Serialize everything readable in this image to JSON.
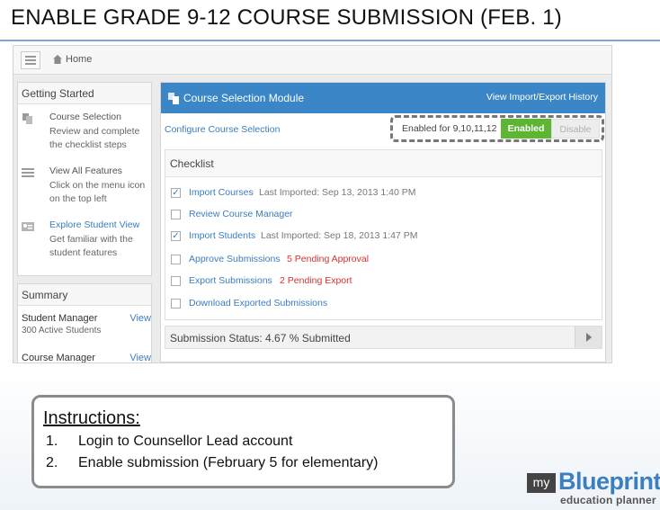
{
  "slide": {
    "title": "ENABLE GRADE 9-12 COURSE SUBMISSION (FEB. 1)"
  },
  "app": {
    "breadcrumb": {
      "home_label": "Home"
    },
    "getting_started": {
      "heading": "Getting Started",
      "items": [
        {
          "icon": "copy-icon",
          "title": "Course Selection",
          "description": "Review and complete the checklist steps"
        },
        {
          "icon": "menu-lines-icon",
          "title": "View All Features",
          "description": "Click on the menu icon on the top left"
        },
        {
          "icon": "id-card-icon",
          "title": "Explore Student View",
          "description": "Get familiar with the student features"
        }
      ]
    },
    "summary": {
      "heading": "Summary",
      "rows": [
        {
          "name": "Student Manager",
          "link": "View",
          "sub": "300 Active Students"
        },
        {
          "name": "Course Manager",
          "link": "View"
        }
      ]
    },
    "module": {
      "title": "Course Selection Module",
      "history_link": "View Import/Export History",
      "configure_link": "Configure Course Selection",
      "enabled_for": "Enabled for 9,10,11,12",
      "enabled_button": "Enabled",
      "disable_button": "Disable",
      "checklist": {
        "heading": "Checklist",
        "items": [
          {
            "label": "Import Courses",
            "checked": true,
            "extra": "Last Imported: Sep 13, 2013 1:40 PM",
            "extra_style": "gray"
          },
          {
            "label": "Review Course Manager",
            "checked": false,
            "extra": "",
            "extra_style": "gray"
          },
          {
            "label": "Import Students",
            "checked": true,
            "extra": "Last Imported: Sep 18, 2013 1:47 PM",
            "extra_style": "gray"
          },
          {
            "label": "Approve Submissions",
            "checked": false,
            "extra": "5 Pending Approval",
            "extra_style": "red"
          },
          {
            "label": "Export Submissions",
            "checked": false,
            "extra": "2 Pending Export",
            "extra_style": "red"
          },
          {
            "label": "Download Exported Submissions",
            "checked": false,
            "extra": "",
            "extra_style": "gray"
          }
        ]
      },
      "submission_status": "Submission Status: 4.67 % Submitted"
    }
  },
  "instructions": {
    "title": "Instructions:",
    "items": [
      {
        "num": "1.",
        "text": "Login to Counsellor Lead account"
      },
      {
        "num": "2.",
        "text": "Enable submission (February 5 for elementary)"
      }
    ]
  },
  "logo": {
    "my": "my",
    "name": "Blueprint",
    "tagline": "education planner"
  },
  "colors": {
    "module_header": "#3a86c6",
    "link": "#3b7dbf",
    "enabled_green": "#5eb533",
    "pending_red": "#d9322d"
  }
}
